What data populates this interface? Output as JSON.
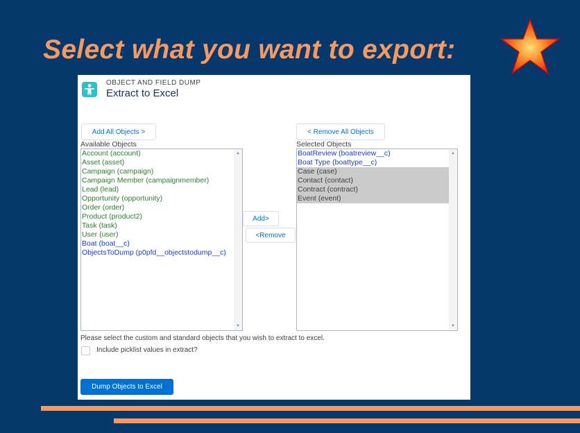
{
  "slide": {
    "title": "Select what you want to export:",
    "title_color": "#f79a62",
    "background": "#06386b",
    "star_icon": "star-icon"
  },
  "app": {
    "kicker": "OBJECT AND FIELD DUMP",
    "title": "Extract to Excel",
    "icon": "person-icon",
    "icon_color": "#2ec0c4"
  },
  "controls": {
    "add_all": "Add All Objects >",
    "remove_all": "< Remove All Objects",
    "add": "Add>",
    "remove": "<Remove"
  },
  "available": {
    "label": "Available Objects",
    "items": [
      {
        "text": "Account (account)",
        "color": "green"
      },
      {
        "text": "Asset (asset)",
        "color": "green"
      },
      {
        "text": "Campaign (campaign)",
        "color": "green"
      },
      {
        "text": "Campaign Member (campaignmember)",
        "color": "green"
      },
      {
        "text": "Lead (lead)",
        "color": "green"
      },
      {
        "text": "Opportunity (opportunity)",
        "color": "green"
      },
      {
        "text": "Order (order)",
        "color": "green"
      },
      {
        "text": "Product (product2)",
        "color": "green"
      },
      {
        "text": "Task (task)",
        "color": "green"
      },
      {
        "text": "User (user)",
        "color": "green"
      },
      {
        "text": "Boat (boat__c)",
        "color": "blue"
      },
      {
        "text": "ObjectsToDump (p0pfd__objectstodump__c)",
        "color": "blue"
      }
    ]
  },
  "selected": {
    "label": "Selected Objects",
    "items": [
      {
        "text": "BoatReview (boatreview__c)",
        "color": "blue"
      },
      {
        "text": "Boat Type (boattype__c)",
        "color": "blue"
      },
      {
        "text": "Case (case)",
        "color": "gray"
      },
      {
        "text": "Contact (contact)",
        "color": "gray"
      },
      {
        "text": "Contract (contract)",
        "color": "gray"
      },
      {
        "text": "Event (event)",
        "color": "gray"
      }
    ]
  },
  "help_text": "Please select the custom and standard objects that you wish to extract to excel.",
  "picklist": {
    "label": "Include picklist values in extract?",
    "checked": false
  },
  "dump_button": "Dump Objects to Excel",
  "colors": {
    "primary": "#0070d2",
    "standard_object": "#2e7d32",
    "custom_object": "#1a3bd1",
    "selected_highlight": "#cbcbcb",
    "accent_stripe": "#f79a62"
  }
}
